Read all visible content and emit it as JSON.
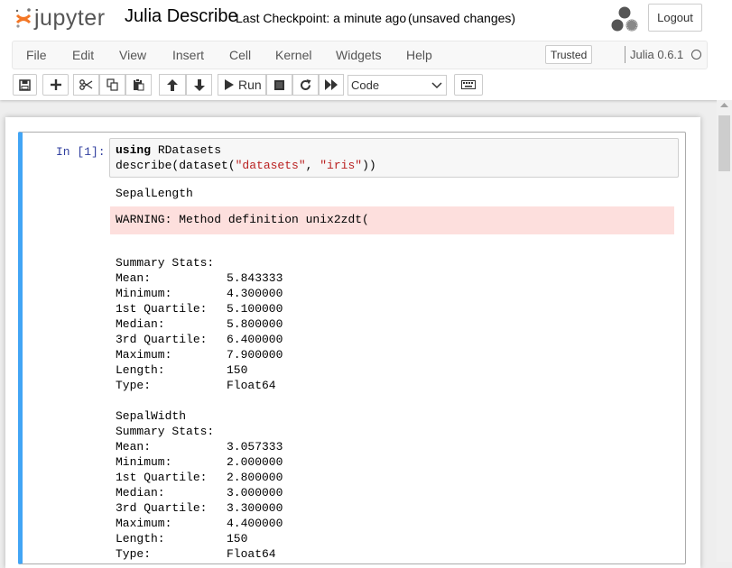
{
  "header": {
    "logo_text": "jupyter",
    "notebook_title": "Julia Describe",
    "checkpoint": "Last Checkpoint: a minute ago",
    "autosave_status": "(unsaved changes)",
    "logout_label": "Logout"
  },
  "menubar": {
    "items": [
      "File",
      "Edit",
      "View",
      "Insert",
      "Cell",
      "Kernel",
      "Widgets",
      "Help"
    ],
    "trusted_label": "Trusted",
    "kernel_name": "Julia 0.6.1"
  },
  "toolbar": {
    "run_label": "Run",
    "cell_type": "Code",
    "icons": [
      "save-icon",
      "plus-icon",
      "cut-icon",
      "copy-icon",
      "paste-icon",
      "arrow-up-icon",
      "arrow-down-icon",
      "play-icon",
      "stop-icon",
      "restart-icon",
      "fast-forward-icon",
      "keyboard-icon"
    ]
  },
  "cell": {
    "prompt": "In [1]:",
    "code": {
      "line1_keyword": "using",
      "line1_rest": " RDatasets",
      "line2_pre": "describe(dataset(",
      "line2_str1": "\"datasets\"",
      "line2_mid": ", ",
      "line2_str2": "\"iris\"",
      "line2_post": "))"
    },
    "output": {
      "heading1": "SepalLength",
      "warning": "WARNING: Method definition unix2zdt(",
      "stats_title": "Summary Stats:",
      "block1": [
        {
          "label": "Mean:",
          "value": "5.843333"
        },
        {
          "label": "Minimum:",
          "value": "4.300000"
        },
        {
          "label": "1st Quartile:",
          "value": "5.100000"
        },
        {
          "label": "Median:",
          "value": "5.800000"
        },
        {
          "label": "3rd Quartile:",
          "value": "6.400000"
        },
        {
          "label": "Maximum:",
          "value": "7.900000"
        },
        {
          "label": "Length:",
          "value": "150"
        },
        {
          "label": "Type:",
          "value": "Float64"
        }
      ],
      "heading2": "SepalWidth",
      "block2": [
        {
          "label": "Mean:",
          "value": "3.057333"
        },
        {
          "label": "Minimum:",
          "value": "2.000000"
        },
        {
          "label": "1st Quartile:",
          "value": "2.800000"
        },
        {
          "label": "Median:",
          "value": "3.000000"
        },
        {
          "label": "3rd Quartile:",
          "value": "3.300000"
        },
        {
          "label": "Maximum:",
          "value": "4.400000"
        },
        {
          "label": "Length:",
          "value": "150"
        },
        {
          "label": "Type:",
          "value": "Float64"
        }
      ]
    }
  },
  "colors": {
    "cell_selected_border": "#42a5f5",
    "warning_background": "#fddfdd",
    "prompt_color": "#303f9f",
    "keyword_green": "#008000",
    "string_red": "#ba2121"
  }
}
